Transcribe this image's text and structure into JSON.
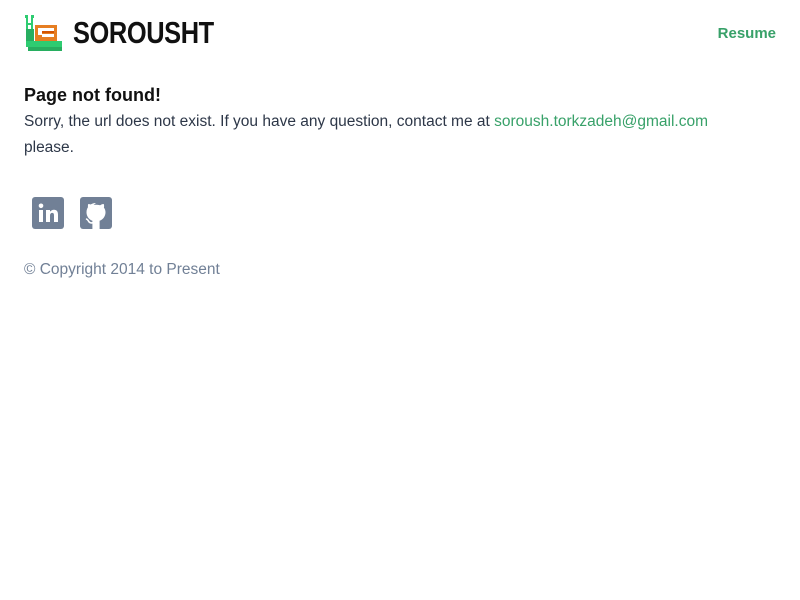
{
  "header": {
    "brand_name": "SOROUSHT",
    "logo_icon": "snail-logo-icon",
    "resume_label": "Resume"
  },
  "main": {
    "title": "Page not found!",
    "message_prefix": "Sorry, the url does not exist. If you have any question, contact me at ",
    "email": "soroush.torkzadeh@gmail.com",
    "message_suffix": " please."
  },
  "socials": [
    {
      "name": "linkedin",
      "icon": "linkedin-icon"
    },
    {
      "name": "github",
      "icon": "github-icon"
    }
  ],
  "footer": {
    "copyright": "© Copyright 2014 to Present"
  },
  "colors": {
    "accent": "#38a169",
    "icon_bg": "#718096",
    "text": "#2d3748",
    "muted": "#718096"
  }
}
